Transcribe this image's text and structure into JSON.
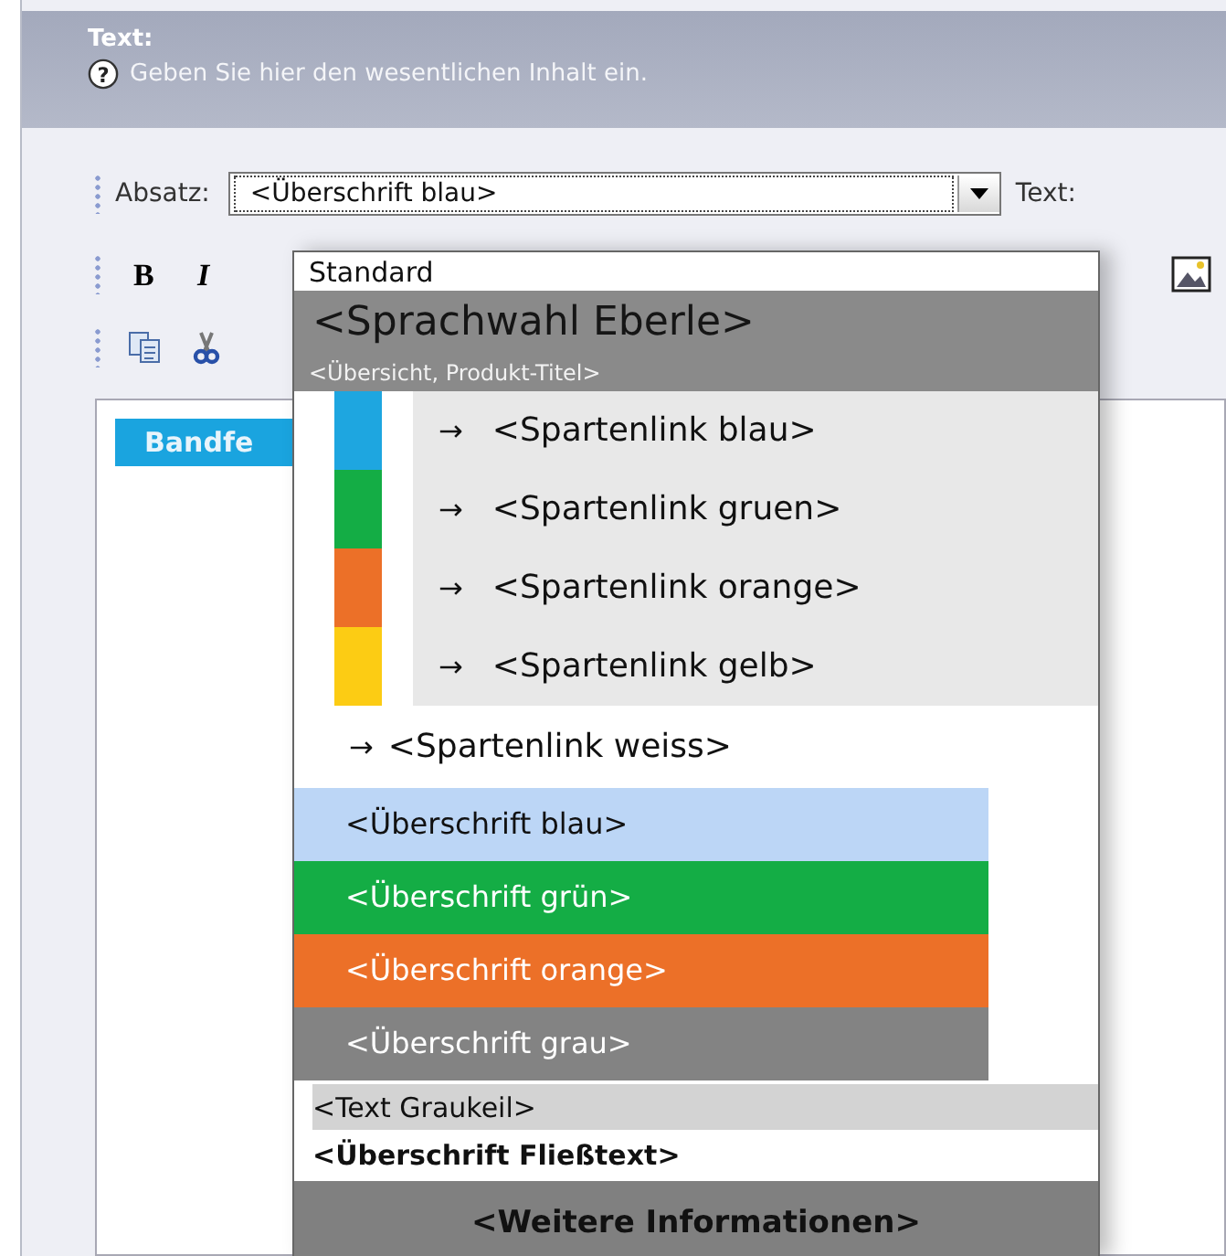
{
  "header": {
    "title": "Text:",
    "help_icon": "?",
    "hint": "Geben Sie hier den wesentlichen Inhalt ein."
  },
  "toolbar": {
    "bold_icon": "B",
    "italic_icon": "I",
    "paragraph_label": "Absatz:",
    "paragraph_value": "<Überschrift blau>",
    "text_label": "Text:"
  },
  "editor": {
    "chip": "Bandfe"
  },
  "dropdown": {
    "options": [
      {
        "kind": "plain",
        "label": "Standard"
      },
      {
        "kind": "large",
        "label": "<Sprachwahl Eberle>"
      },
      {
        "kind": "caption",
        "label": "<Übersicht, Produkt-Titel>"
      },
      {
        "kind": "swatch",
        "marker": "→",
        "label": "<Spartenlink blau>",
        "color": "#1ea6e0"
      },
      {
        "kind": "swatch",
        "marker": "→",
        "label": "<Spartenlink gruen>",
        "color": "#14ad45"
      },
      {
        "kind": "swatch",
        "marker": "→",
        "label": "<Spartenlink orange>",
        "color": "#ec7028"
      },
      {
        "kind": "swatch",
        "marker": "→",
        "label": "<Spartenlink gelb>",
        "color": "#fccc14"
      },
      {
        "kind": "link",
        "marker": "→",
        "label": "<Spartenlink weiss>"
      },
      {
        "kind": "bar",
        "label": "<Überschrift blau>",
        "color": "#bcd6f6"
      },
      {
        "kind": "bar",
        "label": "<Überschrift grün>",
        "color": "#14ad45"
      },
      {
        "kind": "bar",
        "label": "<Überschrift orange>",
        "color": "#ec7028"
      },
      {
        "kind": "bar",
        "label": "<Überschrift grau>",
        "color": "#838383"
      },
      {
        "kind": "graukeil",
        "label": "<Text Graukeil>"
      },
      {
        "kind": "bold",
        "label": "<Überschrift Fließtext>"
      },
      {
        "kind": "info",
        "label": "<Weitere Informationen>"
      }
    ]
  }
}
